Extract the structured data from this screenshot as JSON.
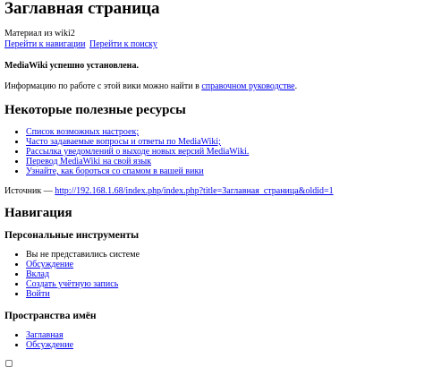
{
  "title": "Заглавная страница",
  "subtitle": "Материал из wiki2",
  "jump_links": {
    "navigation": "Перейти к навигации",
    "search": "Перейти к поиску"
  },
  "content": {
    "installed": "MediaWiki успешно установлена.",
    "info_prefix": "Информацию по работе с этой вики можно найти в ",
    "info_link": "справочном руководстве",
    "info_suffix": "."
  },
  "resources": {
    "heading": "Некоторые полезные ресурсы",
    "items": [
      "Список возможных настроек;",
      "Часто задаваемые вопросы и ответы по MediaWiki;",
      "Рассылка уведомлений о выходе новых версий MediaWiki.",
      "Перевод MediaWiki на свой язык",
      "Узнайте, как бороться со спамом в вашей вики"
    ]
  },
  "source": {
    "label": "Источник — ",
    "url": "http://192.168.1.68/index.php/index.php?title=Заглавная_страница&oldid=1"
  },
  "navigation": {
    "heading": "Навигация",
    "personal": {
      "heading": "Персональные инструменты",
      "not_logged_in": "Вы не представились системе",
      "links": [
        "Обсуждение",
        "Вклад",
        "Создать учётную запись",
        "Войти"
      ]
    },
    "namespaces": {
      "heading": "Пространства имён",
      "links": [
        "Заглавная",
        "Обсуждение"
      ]
    }
  },
  "colors": {
    "link": "#0000ee",
    "text": "#000000",
    "background": "#ffffff"
  }
}
